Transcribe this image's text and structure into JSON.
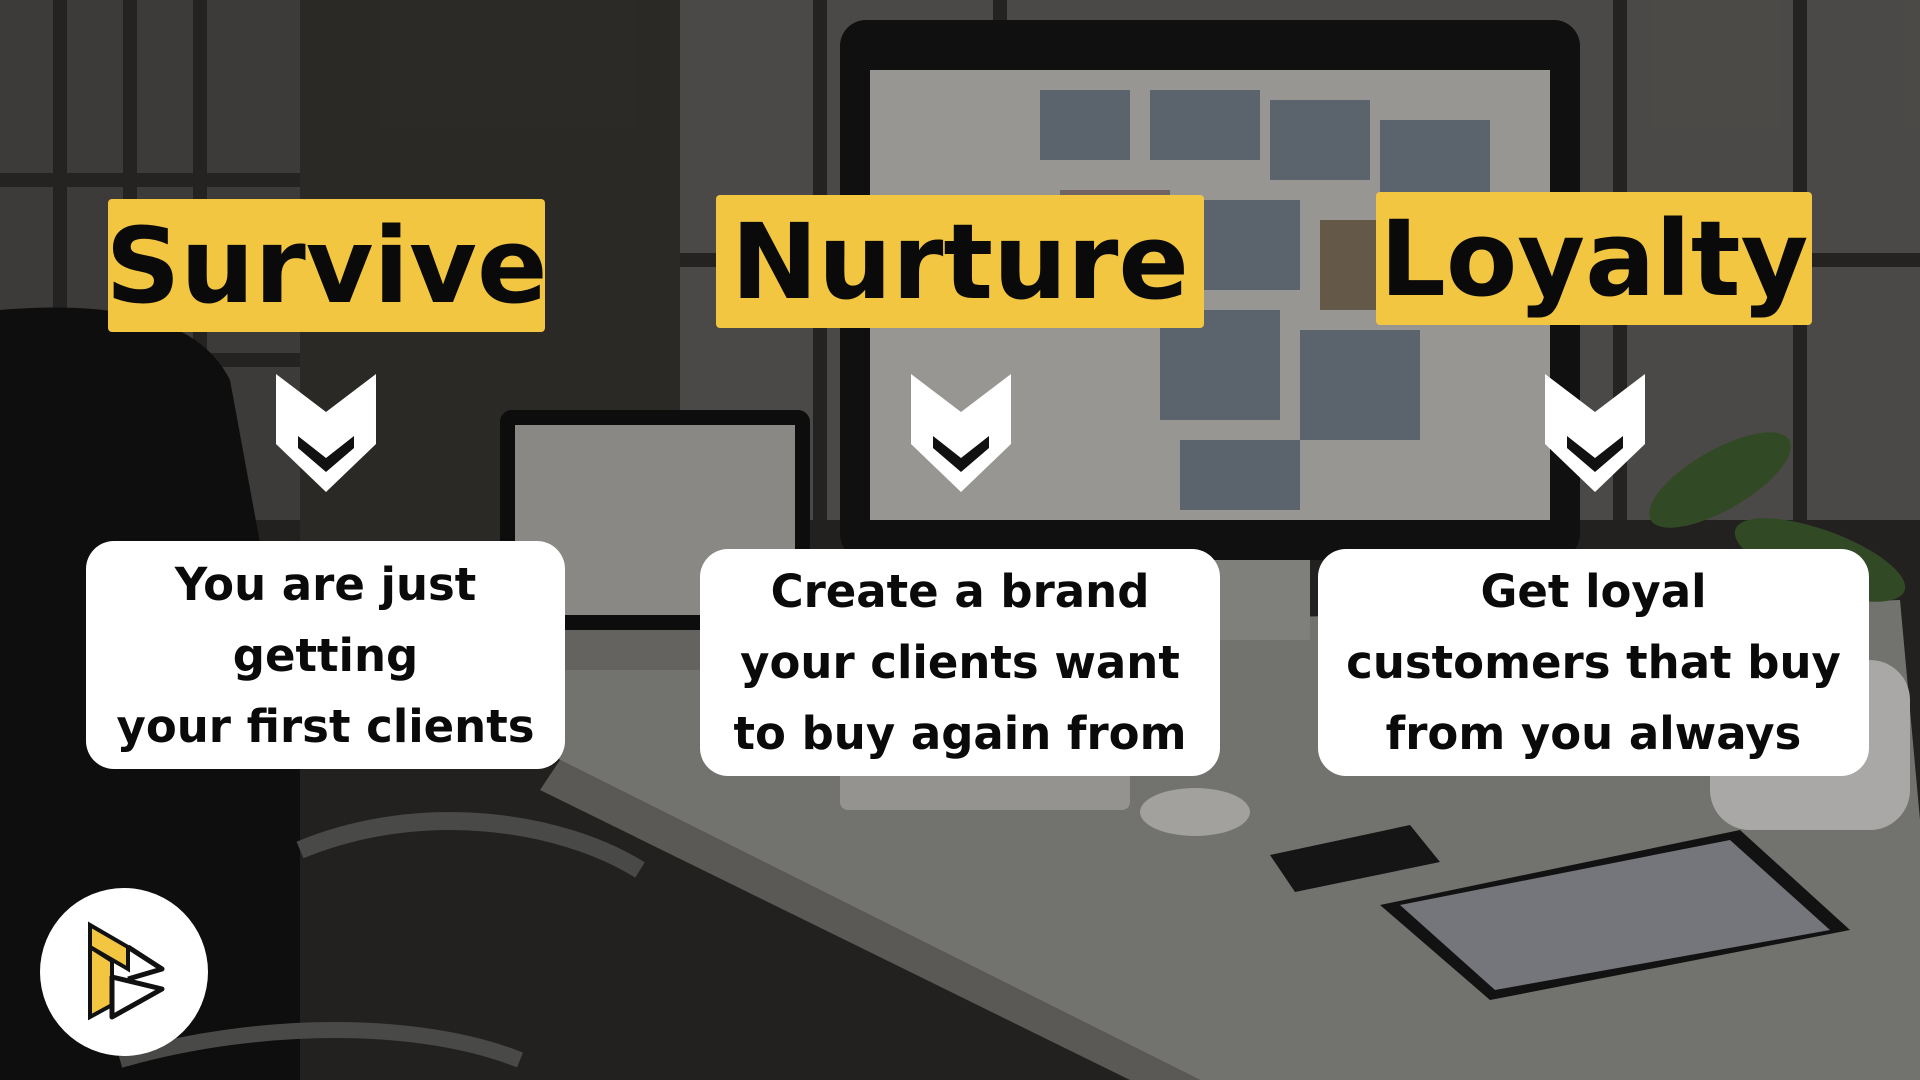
{
  "colors": {
    "accent": "#f2c641",
    "card": "#ffffff",
    "text": "#0a0a0a"
  },
  "stages": [
    {
      "title": "Survive",
      "lines": [
        "You are just",
        "getting",
        "your first clients"
      ]
    },
    {
      "title": "Nurture",
      "lines": [
        "Create a brand",
        "your clients want",
        "to buy again from"
      ]
    },
    {
      "title": "Loyalty",
      "lines": [
        "Get loyal",
        "customers that buy",
        "from you always"
      ]
    }
  ],
  "icons": {
    "arrow": "chevron-down-icon",
    "logo": "brand-logo-icon"
  }
}
